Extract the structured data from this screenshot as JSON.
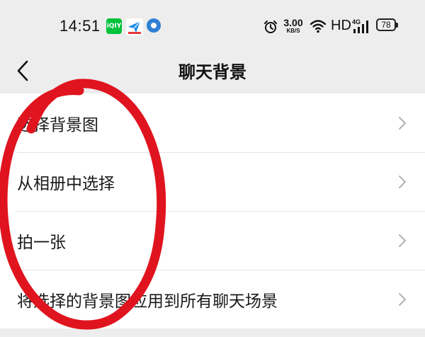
{
  "status_bar": {
    "time": "14:51",
    "app_icons": [
      "iqiyi-icon",
      "paper-plane-icon",
      "blue-dot-icon"
    ],
    "net_speed_value": "3.00",
    "net_speed_unit": "KB/S",
    "hd_label": "HD",
    "signal_label": "4G",
    "battery_level": "78"
  },
  "nav": {
    "back_icon": "chevron-left-icon",
    "title": "聊天背景"
  },
  "settings": {
    "items": [
      {
        "label": "选择背景图"
      },
      {
        "label": "从相册中选择"
      },
      {
        "label": "拍一张"
      },
      {
        "label": "将选择的背景图应用到所有聊天场景"
      }
    ]
  },
  "colors": {
    "page_bg": "#ededed",
    "list_bg": "#ffffff",
    "annotation_stroke": "#e0141e"
  }
}
